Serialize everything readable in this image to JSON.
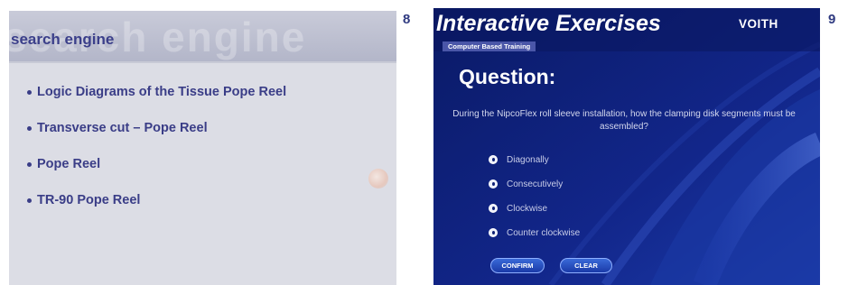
{
  "left": {
    "watermark": "search engine",
    "title": "search engine",
    "items": [
      {
        "label": "Logic Diagrams of the Tissue Pope Reel"
      },
      {
        "label": "Transverse cut – Pope Reel"
      },
      {
        "label": "Pope Reel"
      },
      {
        "label": "TR-90 Pope Reel"
      }
    ]
  },
  "page_numbers": {
    "left": "8",
    "right": "9"
  },
  "right": {
    "title": "Interactive Exercises",
    "subtitle": "Computer Based Training",
    "logo": "VOITH",
    "question_label": "Question:",
    "question_text": "During the NipcoFlex roll sleeve installation, how the clamping disk segments must be assembled?",
    "options": [
      {
        "label": "Diagonally"
      },
      {
        "label": "Consecutively"
      },
      {
        "label": "Clockwise"
      },
      {
        "label": "Counter clockwise"
      }
    ],
    "buttons": {
      "confirm": "CONFIRM",
      "clear": "CLEAR"
    }
  },
  "colors": {
    "left_background": "#dcdde5",
    "left_text": "#3a3d87",
    "right_background": "#0d1f74",
    "page_number": "#2f3a80"
  }
}
